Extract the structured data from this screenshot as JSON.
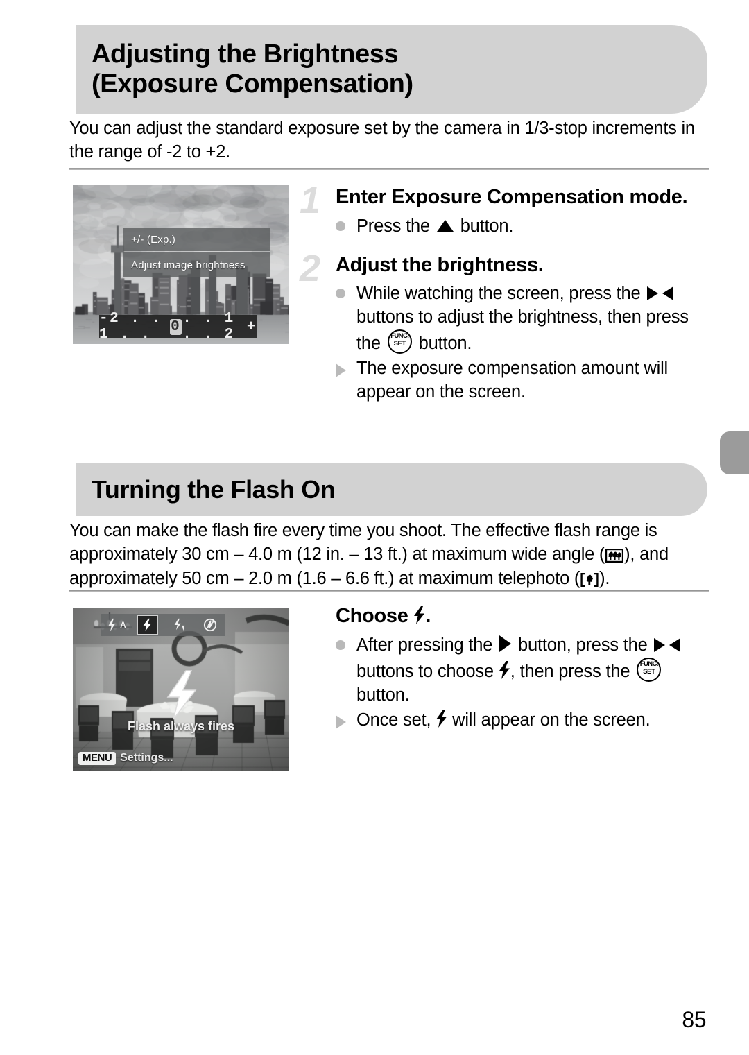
{
  "page": {
    "number": "85",
    "edge_tab_color": "#9b9b9b",
    "banner_color": "#d2d2d2"
  },
  "sections": [
    {
      "title": "Adjusting the Brightness\n(Exposure Compensation)",
      "intro": "You can adjust the standard exposure set by the camera in 1/3-stop increments in the range of -2 to +2.",
      "steps": [
        {
          "number": "1",
          "title": "Enter Exposure Compensation mode.",
          "bullets": [
            {
              "mark": "dot",
              "text_1": "Press the ",
              "icon": "up-button-icon",
              "text_2": " button."
            }
          ]
        },
        {
          "number": "2",
          "title": "Adjust the brightness.",
          "bullets": [
            {
              "mark": "dot",
              "text_1": "While watching the screen, press the ",
              "icon": "left-right-buttons-icon",
              "text_2": " buttons to adjust the brightness, then press the ",
              "icon_2": "func-set-button-icon",
              "text_3": " button."
            },
            {
              "mark": "triangle",
              "text_1": "The exposure compensation amount will appear on the screen."
            }
          ]
        }
      ],
      "screen": {
        "exp_label": "+/- (Exp.)",
        "exp_description": "Adjust image brightness",
        "exposure_scale": {
          "left": "-2 . . 1 . .",
          "zero": "0",
          "right": ". . 1 . . 2",
          "plus": "+"
        }
      }
    },
    {
      "title": "Turning the Flash On",
      "intro_parts": {
        "p1": "You can make the flash fire every time you shoot. The effective flash range is approximately 30 cm – 4.0 m (12 in. – 13 ft.) at maximum wide angle (",
        "p2": "), and approximately 50 cm – 2.0 m (1.6 – 6.6 ft.) at maximum telephoto (",
        "p3": ")."
      },
      "steps": [
        {
          "number": "",
          "title_1": "Choose ",
          "title_icon": "flash-on-icon",
          "title_2": ".",
          "bullets": [
            {
              "mark": "dot",
              "text_1": "After pressing the ",
              "icon": "right-button-icon",
              "text_2": " button, press the ",
              "icon_2": "left-right-buttons-icon",
              "text_3": " buttons to choose ",
              "icon_3": "flash-on-icon",
              "text_4": ", then press the ",
              "icon_4": "func-set-button-icon",
              "text_5": " button."
            },
            {
              "mark": "triangle",
              "text_1": "Once set, ",
              "icon": "flash-on-icon",
              "text_2": " will appear on the screen."
            }
          ]
        }
      ],
      "screen": {
        "flash_modes": [
          {
            "name": "flash-auto",
            "label": "⚡A",
            "selected": false
          },
          {
            "name": "flash-on",
            "label": "⚡",
            "selected": true
          },
          {
            "name": "slow-sync",
            "label": "⚡↓",
            "selected": false
          },
          {
            "name": "flash-off",
            "label": "ⓧ",
            "selected": false
          }
        ],
        "big_icon": "flash-on-icon",
        "caption": "Flash always fires",
        "menu_badge": "MENU",
        "menu_text": "Settings..."
      }
    }
  ]
}
